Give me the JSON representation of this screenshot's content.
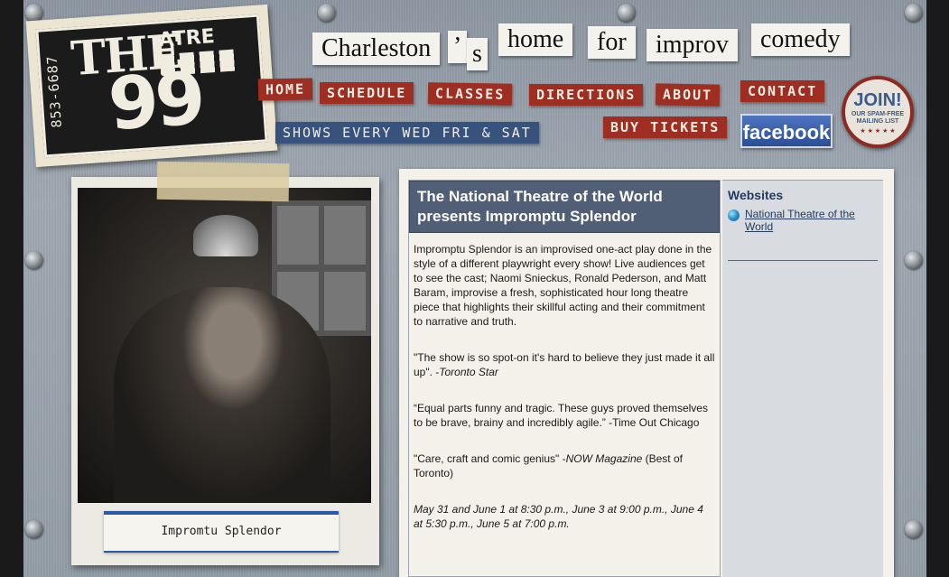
{
  "logo": {
    "the": "THE",
    "atre": "ATRE",
    "number": "99",
    "phone": "853-6687"
  },
  "tagline": [
    "Charleston",
    "’",
    "s",
    "home",
    "for",
    "improv",
    "comedy"
  ],
  "nav": {
    "home": "HOME",
    "schedule": "SCHEDULE",
    "classes": "CLASSES",
    "directions": "DIRECTIONS",
    "about": "ABOUT",
    "contact": "CONTACT",
    "shows": "SHOWS EVERY WED FRI & SAT",
    "buy_tickets": "BUY TICKETS",
    "facebook": "facebook"
  },
  "join": {
    "title": "JOIN!",
    "sub1": "OUR SPAM-FREE",
    "sub2": "MAILING LIST",
    "stars": "★ ★ ★ ★ ★"
  },
  "photo": {
    "caption": "Impromtu Splendor"
  },
  "article": {
    "title": "The National Theatre of the World presents Impromptu Splendor",
    "intro": "Impromptu Splendor is an improvised one-act play done in the style of a different playwright every show!  Live audiences get to see the cast; Naomi Snieckus, Ronald Pederson, and Matt Baram, improvise a fresh, sophisticated hour long theatre piece that highlights their skillful acting and their commitment to narrative and truth.",
    "quote1": "\"The show is so spot-on it's hard to believe they just made it all up\".  -",
    "quote1_source": "Toronto Star",
    "quote2": "“Equal parts funny and tragic. These guys proved themselves to be brave, brainy and incredibly agile.”  -Time Out Chicago",
    "quote3_pre": "\"Care, craft and comic genius\" -",
    "quote3_source": "NOW Magazine",
    "quote3_post": "  (Best of Toronto)",
    "dates": "May 31 and June 1 at 8:30 p.m., June 3 at 9:00 p.m., June 4 at 5:30 p.m., June 5 at 7:00 p.m."
  },
  "sidebar": {
    "title": "Websites",
    "link": "National Theatre of the World"
  }
}
